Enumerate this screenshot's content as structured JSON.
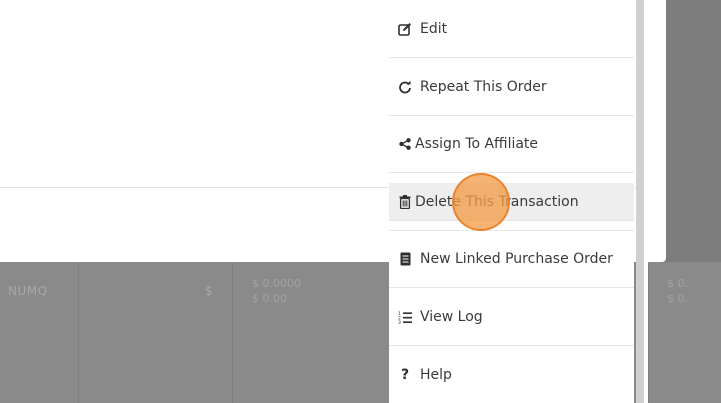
{
  "menu": {
    "items": [
      {
        "label": "Edit",
        "icon": "edit-icon"
      },
      {
        "label": "Repeat This Order",
        "icon": "repeat-icon"
      },
      {
        "label": "Assign To Affiliate",
        "icon": "share-icon"
      },
      {
        "label": "Delete This Transaction",
        "icon": "trash-icon"
      },
      {
        "label": "New Linked Purchase Order",
        "icon": "document-icon"
      },
      {
        "label": "View Log",
        "icon": "list-icon"
      },
      {
        "label": "Help",
        "icon": "question-icon"
      }
    ]
  },
  "background": {
    "table_cells": [
      "NUMQ",
      "$",
      "$ 0.0000\n$ 0.00",
      "$ 0.\n$ 0."
    ]
  },
  "colors": {
    "click_indicator": "#f39c48",
    "hover_bg": "#eeeeee"
  }
}
